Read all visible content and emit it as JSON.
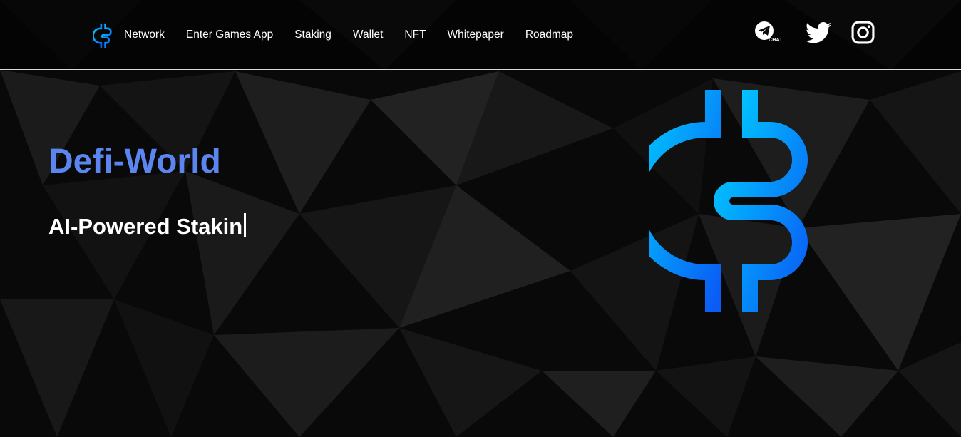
{
  "nav": {
    "items": [
      {
        "label": "Network"
      },
      {
        "label": "Enter Games App"
      },
      {
        "label": "Staking"
      },
      {
        "label": "Wallet"
      },
      {
        "label": "NFT"
      },
      {
        "label": "Whitepaper"
      },
      {
        "label": "Roadmap"
      }
    ]
  },
  "social": {
    "telegram_icon": "telegram-chat-icon",
    "telegram_label": "CHAT",
    "twitter_icon": "twitter-icon",
    "instagram_icon": "instagram-icon"
  },
  "hero": {
    "title": "Defi-World",
    "subtitle": "AI-Powered Stakin"
  },
  "colors": {
    "accent_title": "#5b86f0",
    "logo_gradient_start": "#00d2ff",
    "logo_gradient_end": "#0a5cf5",
    "background": "#0b0b0b"
  }
}
